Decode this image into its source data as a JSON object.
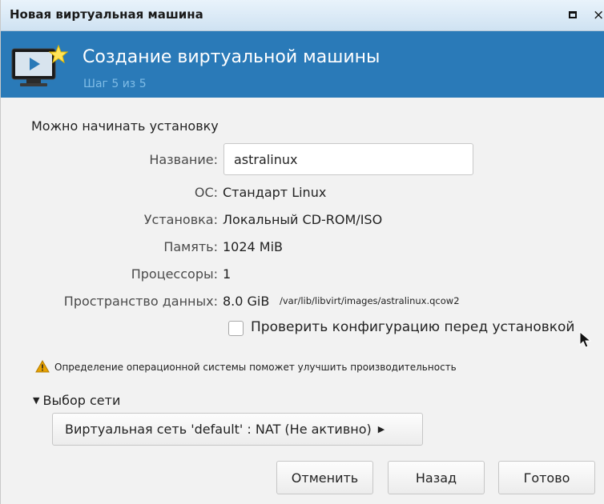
{
  "window": {
    "title": "Новая виртуальная машина",
    "maximize_icon": "maximize-icon",
    "close_glyph": "×"
  },
  "banner": {
    "title": "Создание виртуальной машины",
    "step": "Шаг 5 из 5",
    "icon": "vm-monitor-icon"
  },
  "summary": {
    "heading": "Можно начинать установку",
    "name_label": "Название:",
    "name_value": "astralinux",
    "os_label": "ОС:",
    "os_value": "Стандарт Linux",
    "install_label": "Установка:",
    "install_value": "Локальный CD-ROM/ISO",
    "memory_label": "Память:",
    "memory_value": "1024 MiB",
    "cpu_label": "Процессоры:",
    "cpu_value": "1",
    "storage_label": "Пространство данных:",
    "storage_value": "8.0 GiB",
    "storage_path": "/var/lib/libvirt/images/astralinux.qcow2",
    "customize_label": "Проверить конфигурацию перед установкой",
    "customize_checked": false
  },
  "warning": {
    "text": "Определение операционной системы поможет улучшить производительность",
    "icon": "warning-icon"
  },
  "network": {
    "expander_label": "Выбор сети",
    "selected": "Виртуальная сеть 'default' : NAT (Не активно)"
  },
  "buttons": {
    "cancel": "Отменить",
    "back": "Назад",
    "finish": "Готово"
  },
  "colors": {
    "banner": "#2a7ab8",
    "banner_step": "#7fbce6",
    "warning": "#e8a200"
  }
}
